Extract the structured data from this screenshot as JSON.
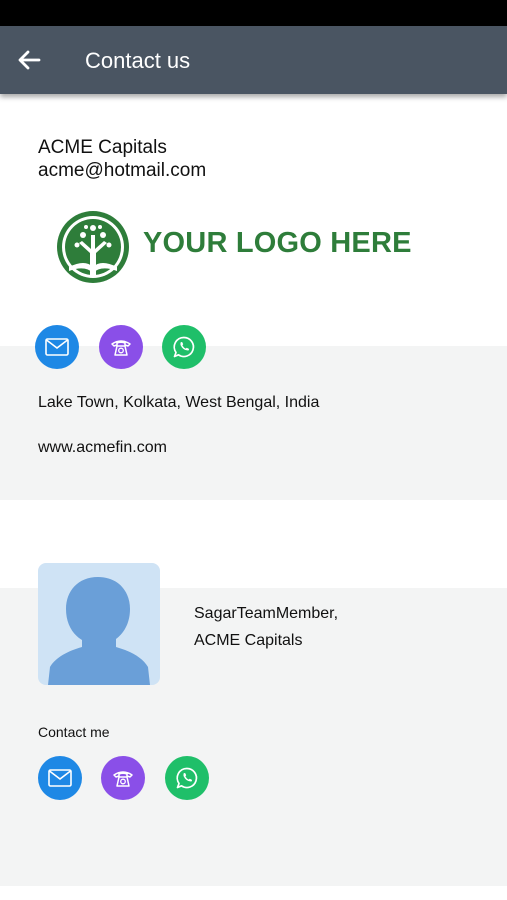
{
  "header": {
    "title": "Contact us"
  },
  "company": {
    "name": "ACME Capitals",
    "email": "acme@hotmail.com",
    "logo_text": "YOUR LOGO HERE",
    "address": "Lake Town, Kolkata, West Bengal, India",
    "website": "www.acmefin.com"
  },
  "member": {
    "name": "SagarTeamMember,",
    "company": "ACME Capitals",
    "contact_label": "Contact me"
  },
  "icons": {
    "email": "mail-icon",
    "phone": "telephone-icon",
    "whatsapp": "whatsapp-icon",
    "back": "arrow-left-icon"
  },
  "colors": {
    "app_bar": "#4a5562",
    "email_button": "#1e88e5",
    "phone_button": "#8a4fe8",
    "whatsapp_button": "#1fbf69",
    "logo_green": "#2e7d3a",
    "panel_gray": "#f3f4f4"
  }
}
